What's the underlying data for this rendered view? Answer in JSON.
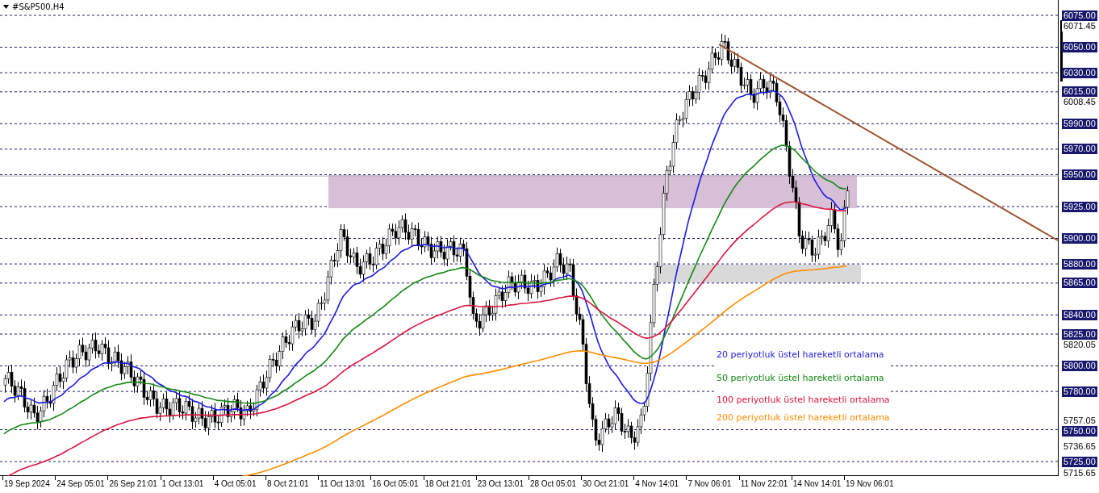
{
  "symbol": {
    "title": "#S&P500,H4"
  },
  "price_axis": {
    "labels": [
      {
        "text": "6075.00",
        "kind": "level"
      },
      {
        "text": "6071.45",
        "kind": "plain"
      },
      {
        "text": "6050.00",
        "kind": "level"
      },
      {
        "text": "6030.00",
        "kind": "level"
      },
      {
        "text": "6015.00",
        "kind": "level"
      },
      {
        "text": "6008.45",
        "kind": "plain"
      },
      {
        "text": "5990.00",
        "kind": "level"
      },
      {
        "text": "5970.00",
        "kind": "level"
      },
      {
        "text": "5950.00",
        "kind": "level"
      },
      {
        "text": "5925.00",
        "kind": "level"
      },
      {
        "text": "5900.00",
        "kind": "level"
      },
      {
        "text": "5880.00",
        "kind": "level"
      },
      {
        "text": "5865.00",
        "kind": "level"
      },
      {
        "text": "5840.00",
        "kind": "level"
      },
      {
        "text": "5825.00",
        "kind": "level"
      },
      {
        "text": "5820.05",
        "kind": "plain"
      },
      {
        "text": "5800.00",
        "kind": "level"
      },
      {
        "text": "5780.00",
        "kind": "level"
      },
      {
        "text": "5757.05",
        "kind": "plain"
      },
      {
        "text": "5750.00",
        "kind": "level"
      },
      {
        "text": "5736.65",
        "kind": "plain"
      },
      {
        "text": "5725.00",
        "kind": "level"
      },
      {
        "text": "5715.65",
        "kind": "plain"
      }
    ]
  },
  "time_axis": {
    "labels": [
      "19 Sep 2024",
      "24 Sep 05:01",
      "26 Sep 21:01",
      "1 Oct 13:01",
      "4 Oct 05:01",
      "8 Oct 21:01",
      "11 Oct 13:01",
      "16 Oct 05:01",
      "18 Oct 21:01",
      "23 Oct 13:01",
      "28 Oct 05:01",
      "30 Oct 21:01",
      "4 Nov 14:01",
      "7 Nov 06:01",
      "11 Nov 22:01",
      "14 Nov 14:01",
      "19 Nov 06:01"
    ]
  },
  "legend": [
    {
      "text": "20 periyotluk üstel hareketli ortalama",
      "color": "#1a1ae0"
    },
    {
      "text": "50 periyotluk üstel hareketli ortalama",
      "color": "#138a13"
    },
    {
      "text": "100 periyotluk üstel hareketli ortalama",
      "color": "#dc143c"
    },
    {
      "text": "200 periyotluk üstel hareketli ortalama",
      "color": "#ff8c00"
    }
  ]
}
